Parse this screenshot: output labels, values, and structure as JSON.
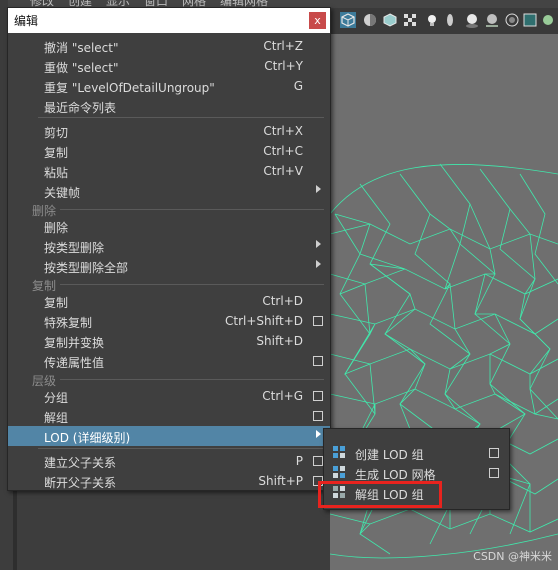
{
  "menubar": {
    "items": [
      "编辑",
      "修改",
      "创建",
      "显示",
      "窗口",
      "网格",
      "编辑网格"
    ]
  },
  "menu": {
    "title": "编辑",
    "close_glyph": "x",
    "items": [
      {
        "label": "撤消 \"select\"",
        "shortcut": "Ctrl+Z"
      },
      {
        "label": "重做 \"select\"",
        "shortcut": "Ctrl+Y"
      },
      {
        "label": "重复 \"LevelOfDetailUngroup\"",
        "shortcut": "G"
      },
      {
        "label": "最近命令列表",
        "shortcut": ""
      },
      {
        "label": "剪切",
        "shortcut": "Ctrl+X"
      },
      {
        "label": "复制",
        "shortcut": "Ctrl+C"
      },
      {
        "label": "粘贴",
        "shortcut": "Ctrl+V"
      },
      {
        "label": "关键帧",
        "shortcut": ""
      },
      {
        "label": "删除",
        "shortcut": ""
      },
      {
        "label": "按类型删除",
        "shortcut": ""
      },
      {
        "label": "按类型删除全部",
        "shortcut": ""
      },
      {
        "label": "复制",
        "shortcut": "Ctrl+D"
      },
      {
        "label": "特殊复制",
        "shortcut": "Ctrl+Shift+D"
      },
      {
        "label": "复制并变换",
        "shortcut": "Shift+D"
      },
      {
        "label": "传递属性值",
        "shortcut": ""
      },
      {
        "label": "分组",
        "shortcut": "Ctrl+G"
      },
      {
        "label": "解组",
        "shortcut": ""
      },
      {
        "label": "LOD (详细级别)",
        "shortcut": ""
      },
      {
        "label": "建立父子关系",
        "shortcut": "P"
      },
      {
        "label": "断开父子关系",
        "shortcut": "Shift+P"
      }
    ],
    "sections": [
      "删除",
      "复制",
      "层级"
    ]
  },
  "submenu": {
    "items": [
      {
        "label": "创建 LOD 组"
      },
      {
        "label": "生成 LOD 网格"
      },
      {
        "label": "解组 LOD 组"
      }
    ]
  },
  "watermark": "CSDN @神米米",
  "colors": {
    "highlight": "#5285a6",
    "mesh": "#3ef0b0",
    "annotation": "#e8231e"
  }
}
